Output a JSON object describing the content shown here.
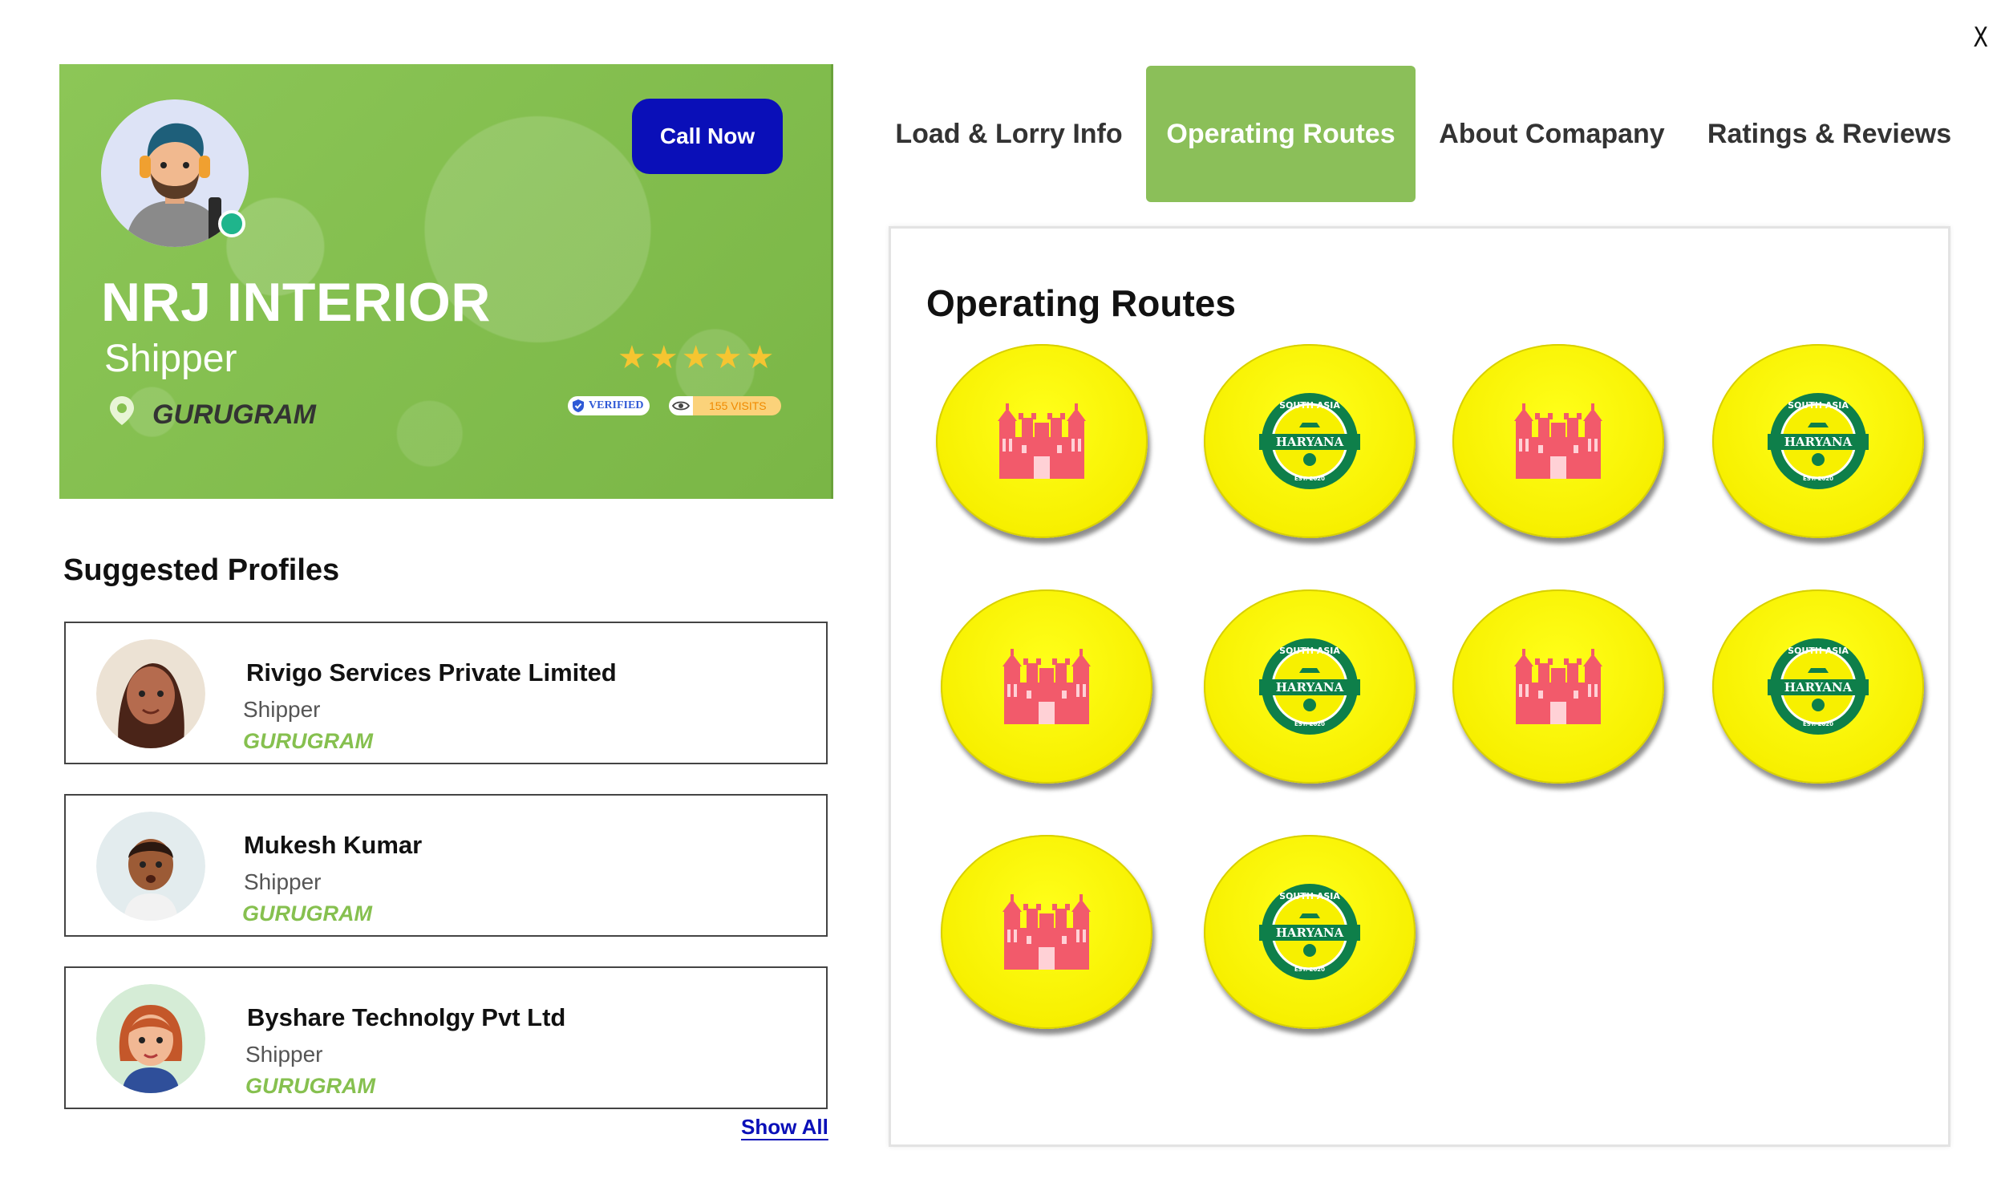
{
  "close_label": "X",
  "profile": {
    "name": "NRJ INTERIOR",
    "role": "Shipper",
    "city": "GURUGRAM",
    "call_label": "Call Now",
    "rating_stars": 5,
    "verified_label": "VERIFIED",
    "visits_label": "155 VISITS",
    "colors": {
      "card_bg": "#86c04f",
      "call_button": "#0a0fb8",
      "online": "#1fb58c",
      "star": "#f5c531"
    }
  },
  "suggested": {
    "title": "Suggested Profiles",
    "items": [
      {
        "name": "Rivigo Services Private Limited",
        "role": "Shipper",
        "city": "GURUGRAM"
      },
      {
        "name": "Mukesh Kumar",
        "role": "Shipper",
        "city": "GURUGRAM"
      },
      {
        "name": "Byshare Technolgy Pvt Ltd",
        "role": "Shipper",
        "city": "GURUGRAM"
      }
    ],
    "show_all_label": "Show All"
  },
  "tabs": [
    {
      "label": "Load & Lorry Info",
      "active": false
    },
    {
      "label": "Operating Routes",
      "active": true
    },
    {
      "label": "About Comapany",
      "active": false
    },
    {
      "label": "Ratings & Reviews",
      "active": false
    }
  ],
  "routes": {
    "title": "Operating Routes",
    "badges": [
      {
        "icon": "red-fort-icon"
      },
      {
        "icon": "haryana-emblem-icon",
        "emblem_text": "HARYANA",
        "ring_text": "SOUTH ASIA",
        "est": "EST. 2020"
      },
      {
        "icon": "red-fort-icon"
      },
      {
        "icon": "haryana-emblem-icon",
        "emblem_text": "HARYANA",
        "ring_text": "SOUTH ASIA",
        "est": "EST. 2020"
      },
      {
        "icon": "red-fort-icon"
      },
      {
        "icon": "haryana-emblem-icon",
        "emblem_text": "HARYANA",
        "ring_text": "SOUTH ASIA",
        "est": "EST. 2020"
      },
      {
        "icon": "red-fort-icon"
      },
      {
        "icon": "haryana-emblem-icon",
        "emblem_text": "HARYANA",
        "ring_text": "SOUTH ASIA",
        "est": "EST. 2020"
      },
      {
        "icon": "red-fort-icon"
      },
      {
        "icon": "haryana-emblem-icon",
        "emblem_text": "HARYANA",
        "ring_text": "SOUTH ASIA",
        "est": "EST. 2020"
      }
    ],
    "colors": {
      "badge": "#ffff00",
      "fort": "#f25a6b",
      "emblem": "#0e7f4a"
    }
  }
}
